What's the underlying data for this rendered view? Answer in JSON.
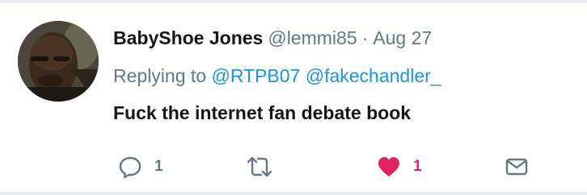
{
  "tweet": {
    "display_name": "BabyShoe Jones",
    "handle": "@lemmi85",
    "separator": "·",
    "date": "Aug 27",
    "replying_prefix": "Replying to",
    "mentions": [
      "@RTPB07",
      "@fakechandler_"
    ],
    "text": "Fuck the internet fan debate book"
  },
  "actions": {
    "reply_count": "1",
    "retweet_count": "",
    "like_count": "1"
  },
  "colors": {
    "name": "#14171a",
    "muted": "#657786",
    "link": "#1b95e0",
    "like": "#e0245e",
    "divider": "#e6ecf0"
  },
  "icons": {
    "reply": "reply-icon",
    "retweet": "retweet-icon",
    "like": "heart-icon",
    "message": "envelope-icon"
  }
}
